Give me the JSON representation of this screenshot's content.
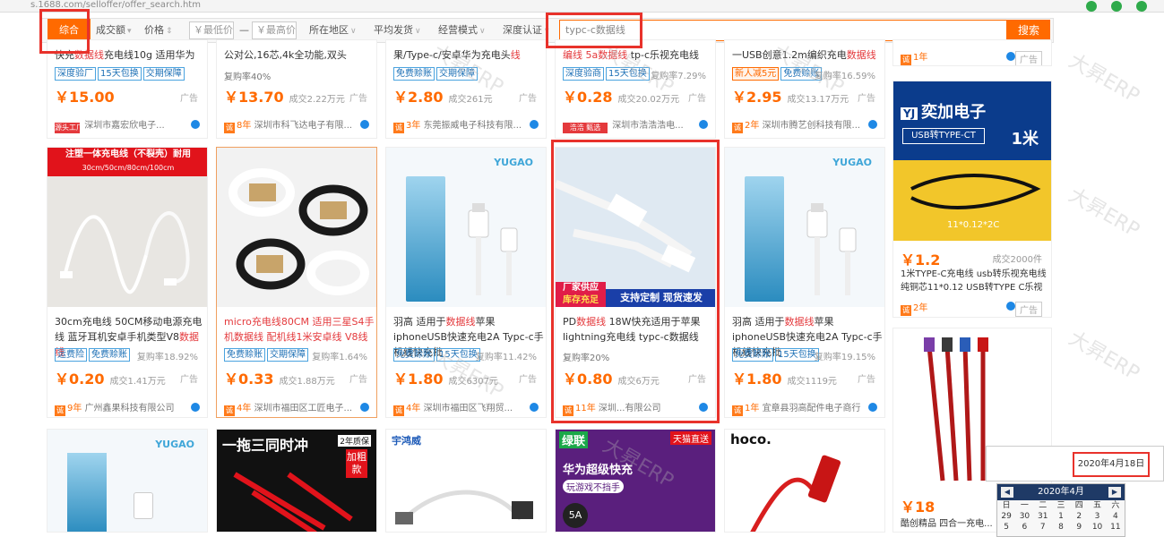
{
  "browser": {
    "url_fragment": "s.1688.com/selloffer/offer_search.htm"
  },
  "filters": {
    "zonghe": "综合",
    "volume": "成交额",
    "price": "价格",
    "min_price": "￥最低价",
    "dash": "—",
    "max_price": "￥最高价",
    "region": "所在地区",
    "avg_ship": "平均发货",
    "biz_mode": "经营模式",
    "depth": "深度认证"
  },
  "search": {
    "value": "typc-c数据线",
    "button": "搜索"
  },
  "row1": [
    {
      "title_a": "快充",
      "title_r": "数据线",
      "title_b": "充电线10g 适用华为",
      "tags": [
        "深度验厂",
        "15天包换",
        "交期保障"
      ],
      "rate": "",
      "price": "￥15.00",
      "sales": "",
      "ad": "广告",
      "badge": "源头工厂",
      "company": "深圳市嘉宏欣电子..."
    },
    {
      "title_a": "公对公,16芯,4k全功能,双头",
      "title_r": "",
      "title_b": "",
      "tags": [],
      "rate": "复购率40%",
      "price": "￥13.70",
      "sales": "成交2.22万元",
      "ad": "广告",
      "badge": "8年",
      "company": "深圳市科飞达电子有限..."
    },
    {
      "title_a": "果/Type-c/安卓华为充电头",
      "title_r": "线",
      "title_b": "",
      "tags": [
        "免费赊账",
        "交期保障"
      ],
      "rate": "",
      "price": "￥2.80",
      "sales": "成交261元",
      "ad": "广告",
      "badge": "3年",
      "company": "东莞振威电子科技有限..."
    },
    {
      "title_a": "",
      "title_r": "编线 5a数据线",
      "title_b": " tp-c乐视充电线",
      "tags": [
        "深度验商",
        "15天包换"
      ],
      "rate": "复购率7.29%",
      "price": "￥0.28",
      "sales": "成交20.02万元",
      "ad": "广告",
      "badge": "浩浩 甄选",
      "company": "深圳市浩浩浩电..."
    },
    {
      "title_a": "一USB创意1.2m编织充电",
      "title_r": "数据线",
      "title_b": "",
      "tags": [
        "新人减5元",
        "免费赊账"
      ],
      "rate": "复购率16.59%",
      "price": "￥2.95",
      "sales": "成交13.17万元",
      "ad": "广告",
      "badge": "2年",
      "company": "深圳市腾艺创科技有限..."
    },
    {
      "title_a": "",
      "title_r": "",
      "title_b": "",
      "tags": [],
      "rate": "",
      "price": "",
      "sales": "",
      "ad": "广告",
      "badge": "1年",
      "company": ""
    }
  ],
  "row2": [
    {
      "banner": "注塑一体充电线（不裂壳）耐用",
      "banner_sub": "30cm/50cm/80cm/100cm",
      "title_a": "30cm充电线 50CM移动电源充电线 蓝牙耳机安卓手机类型V8",
      "title_r": "数据线",
      "tags": [
        "运费险",
        "免费赊账"
      ],
      "rate": "复购率18.92%",
      "price": "￥0.20",
      "sales": "成交1.41万元",
      "ad": "广告",
      "badge": "9年",
      "company": "广州鑫果科技有限公司"
    },
    {
      "title_a": "micro充电线80CM 适用三星S4手机",
      "title_r": "数据线 配机线1米安卓线 V8线",
      "tags": [
        "免费赊账",
        "交期保障"
      ],
      "rate": "复购率1.64%",
      "price": "￥0.33",
      "sales": "成交1.88万元",
      "ad": "广告",
      "badge": "4年",
      "company": "深圳市福田区工匠电子..."
    },
    {
      "brand": "YUGAO",
      "title_a": "羽高 适用于",
      "title_r": "数据线",
      "title_b": "苹果iphoneUSB快速充电2A Typc-c手机线快充批",
      "tags": [
        "免费赊账",
        "15天包换"
      ],
      "rate": "复购率11.42%",
      "price": "￥1.80",
      "sales": "成交6307元",
      "ad": "广告",
      "badge": "4年",
      "company": "深圳市福田区飞翔贸..."
    },
    {
      "banner_l1": "厂家供应",
      "banner_l2": "库存充足",
      "banner_r": "支持定制 现货速发",
      "title_a": "PD",
      "title_r": "数据线",
      "title_b": " 18W快充适用于苹果lightning充电线 typc-c数据线",
      "tags": [],
      "rate": "复购率20%",
      "price": "￥0.80",
      "sales": "成交6万元",
      "ad": "广告",
      "badge": "11年",
      "company": "深圳...有限公司"
    },
    {
      "brand": "YUGAO",
      "title_a": "羽高 适用于",
      "title_r": "数据线",
      "title_b": "苹果iphoneUSB快速充电2A Typc-c手机线快充批",
      "tags": [
        "免费赊账",
        "15天包换"
      ],
      "rate": "复购率19.15%",
      "price": "￥1.80",
      "sales": "成交1119元",
      "ad": "广告",
      "badge": "1年",
      "company": "宜章县羽高配件电子商行"
    },
    {
      "logo_text": "奕加电子",
      "logo_sub": "USB转TYPE-CT",
      "logo_len": "1米",
      "spec": "11*0.12*2C",
      "price": "￥1.2",
      "sales": "成交2000件",
      "title_a": "1米TYPE-C充电线 usb转乐视充电线 纯铜芯11*0.12 USB转TYPE C乐视",
      "ad": "广告",
      "badge": "2年"
    }
  ],
  "row3": [
    {
      "brand": "YUGAO"
    },
    {
      "t1": "一拖三同时冲",
      "t2": "2年质保",
      "t3": "加粗款"
    },
    {
      "brand": "宇鸿威"
    },
    {
      "b1": "绿联",
      "b2": "天猫直送",
      "b3": "华为超级快充",
      "b4": "玩游戏不挡手",
      "b5": "5A"
    },
    {
      "brand": "hoco."
    },
    {
      "price": "￥18",
      "title_a": "酷创精品 四合一充电..."
    }
  ],
  "watermark": "大昇ERP",
  "date_badge": "2020年4月18日",
  "calendar": {
    "month": "2020年4月",
    "weekdays": [
      "日",
      "一",
      "二",
      "三",
      "四",
      "五",
      "六"
    ],
    "week1": [
      "29",
      "30",
      "31",
      "1",
      "2",
      "3",
      "4"
    ],
    "week2": [
      "5",
      "6",
      "7",
      "8",
      "9",
      "10",
      "11"
    ]
  },
  "colors": {
    "accent": "#ff6a00",
    "highlight": "#e8322b",
    "link": "#1c6fb5"
  }
}
